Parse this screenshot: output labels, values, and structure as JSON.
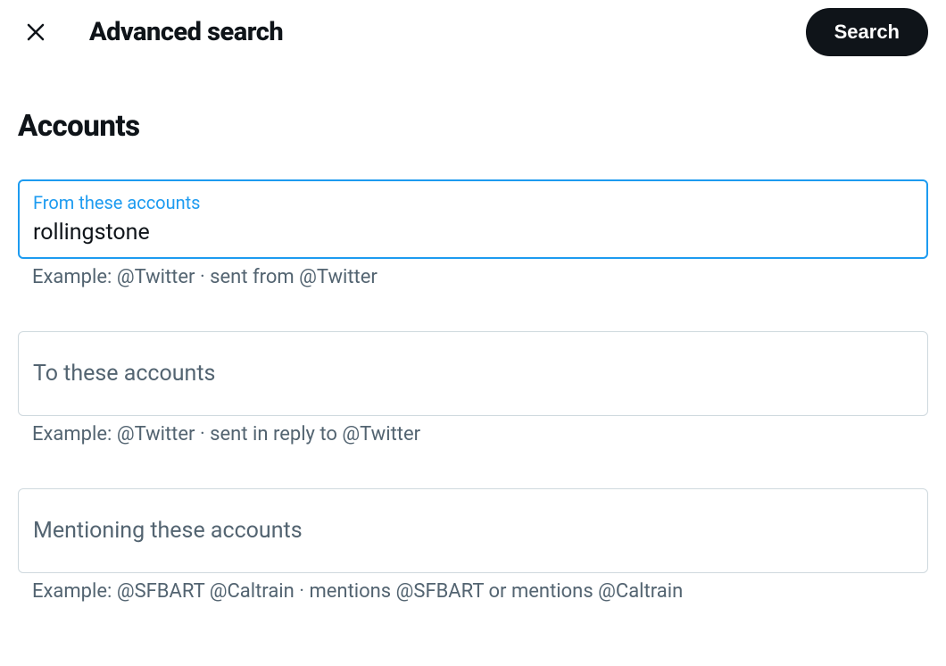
{
  "header": {
    "title": "Advanced search",
    "search_button": "Search"
  },
  "section": {
    "title": "Accounts"
  },
  "fields": {
    "from": {
      "label": "From these accounts",
      "value": "rollingstone",
      "example": "Example: @Twitter · sent from @Twitter"
    },
    "to": {
      "label": "To these accounts",
      "value": "",
      "example": "Example: @Twitter · sent in reply to @Twitter"
    },
    "mentioning": {
      "label": "Mentioning these accounts",
      "value": "",
      "example": "Example: @SFBART @Caltrain · mentions @SFBART or mentions @Caltrain"
    }
  }
}
